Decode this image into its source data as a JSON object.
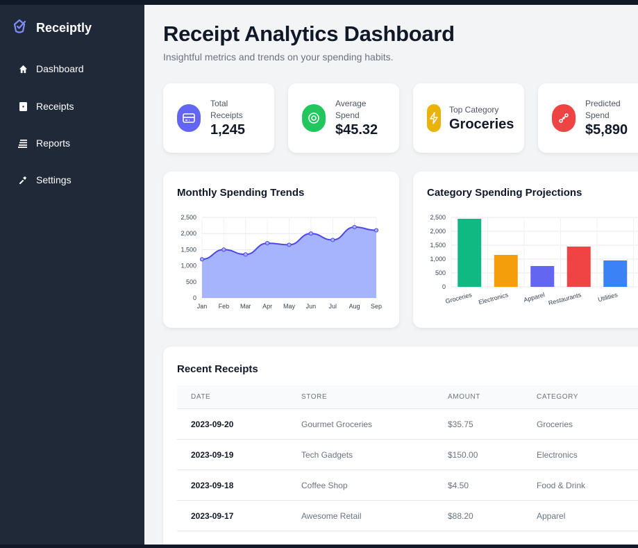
{
  "brand": {
    "name": "Receiptly",
    "icon": "receipt-check-icon",
    "accent": "#818cf8"
  },
  "nav": [
    {
      "label": "Dashboard",
      "icon": "home-icon"
    },
    {
      "label": "Receipts",
      "icon": "receipt-icon"
    },
    {
      "label": "Reports",
      "icon": "list-icon"
    },
    {
      "label": "Settings",
      "icon": "wrench-icon"
    }
  ],
  "header": {
    "title": "Receipt Analytics Dashboard",
    "subtitle": "Insightful metrics and trends on your spending habits."
  },
  "stats": [
    {
      "label": "Total Receipts",
      "value": "1,245",
      "icon": "credit-card-icon",
      "color": "#6366f1"
    },
    {
      "label": "Average Spend",
      "value": "$45.32",
      "icon": "target-icon",
      "color": "#22c55e"
    },
    {
      "label": "Top Category",
      "value": "Groceries",
      "icon": "lightning-icon",
      "color": "#eab308"
    },
    {
      "label": "Predicted Spend",
      "value": "$5,890",
      "icon": "link-icon",
      "color": "#ef4444"
    }
  ],
  "charts": {
    "trend_title": "Monthly Spending Trends",
    "projection_title": "Category Spending Projections"
  },
  "chart_data": [
    {
      "type": "area",
      "title": "Monthly Spending Trends",
      "categories": [
        "Jan",
        "Feb",
        "Mar",
        "Apr",
        "May",
        "Jun",
        "Jul",
        "Aug",
        "Sep"
      ],
      "values": [
        1200,
        1500,
        1350,
        1700,
        1650,
        2000,
        1800,
        2200,
        2100
      ],
      "ylim": [
        0,
        2500
      ],
      "yticks": [
        "0",
        "500",
        "1,000",
        "1,500",
        "2,000",
        "2,500"
      ],
      "color": "#a5b4fc",
      "line_color": "#4f46e5",
      "grid": true
    },
    {
      "type": "bar",
      "title": "Category Spending Projections",
      "categories": [
        "Groceries",
        "Electronics",
        "Apparel",
        "Restaurants",
        "Utilities"
      ],
      "values": [
        2450,
        1150,
        750,
        1450,
        950
      ],
      "colors": [
        "#10b981",
        "#f59e0b",
        "#6366f1",
        "#ef4444",
        "#3b82f6"
      ],
      "ylim": [
        0,
        2500
      ],
      "yticks": [
        "0",
        "500",
        "1,000",
        "1,500",
        "2,000",
        "2,500"
      ],
      "grid": true
    }
  ],
  "table": {
    "title": "Recent Receipts",
    "columns": [
      "DATE",
      "STORE",
      "AMOUNT",
      "CATEGORY"
    ],
    "rows": [
      {
        "date": "2023-09-20",
        "store": "Gourmet Groceries",
        "amount": "$35.75",
        "category": "Groceries"
      },
      {
        "date": "2023-09-19",
        "store": "Tech Gadgets",
        "amount": "$150.00",
        "category": "Electronics"
      },
      {
        "date": "2023-09-18",
        "store": "Coffee Shop",
        "amount": "$4.50",
        "category": "Food & Drink"
      },
      {
        "date": "2023-09-17",
        "store": "Awesome Retail",
        "amount": "$88.20",
        "category": "Apparel"
      }
    ]
  }
}
